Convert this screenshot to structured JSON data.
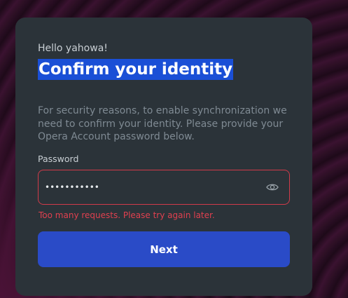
{
  "greeting": "Hello yahowa!",
  "title": "Confirm your identity",
  "description": "For security reasons, to enable synchronization we need to confirm your identity. Please provide your Opera Account password below.",
  "password": {
    "label": "Password",
    "value": "•••••••••••",
    "toggle_icon": "eye-icon"
  },
  "error_message": "Too many requests. Please try again later.",
  "next_button": "Next",
  "colors": {
    "card_bg": "#2b3339",
    "accent": "#2a4bc7",
    "title_highlight": "#1a4fd6",
    "error": "#e0404f"
  }
}
